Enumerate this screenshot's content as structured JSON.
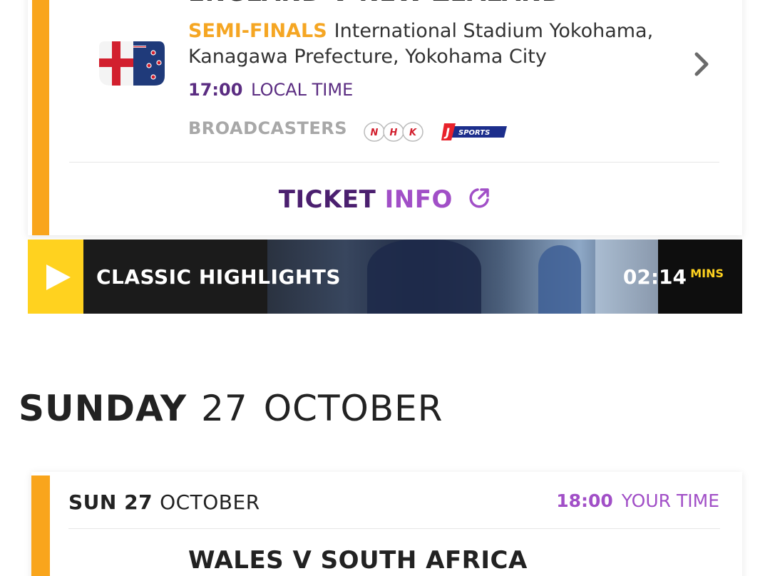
{
  "match1": {
    "title": "ENGLAND V NEW ZEALAND",
    "stage": "SEMI-FINALS",
    "venue": "International Stadium Yokohama, Kanagawa Prefecture, Yokohama City",
    "kickoff_time": "17:00",
    "kickoff_label": "LOCAL TIME",
    "broadcasters_label": "BROADCASTERS",
    "broadcasters": [
      "NHK",
      "J SPORTS"
    ],
    "ticket_a": "TICKET",
    "ticket_b": "INFO",
    "icons": {
      "flags": "england-newzealand-flags-icon",
      "chevron": "chevron-right-icon",
      "external": "external-link-icon"
    }
  },
  "highlights": {
    "label": "CLASSIC HIGHLIGHTS",
    "duration": "02:14",
    "unit": "MINS",
    "icon": "play-icon"
  },
  "day_heading": {
    "day": "SUNDAY",
    "date": "27",
    "month": "OCTOBER"
  },
  "match2": {
    "date_day": "SUN 27",
    "date_month": "OCTOBER",
    "time": "18:00",
    "time_label": "YOUR TIME",
    "title": "WALES V SOUTH AFRICA"
  },
  "colors": {
    "accent_orange": "#f9a51c",
    "stage_gold": "#f5a623",
    "purple_dark": "#4b1f6f",
    "purple_light": "#a14fc7",
    "highlight_yellow": "#ffd21f"
  }
}
